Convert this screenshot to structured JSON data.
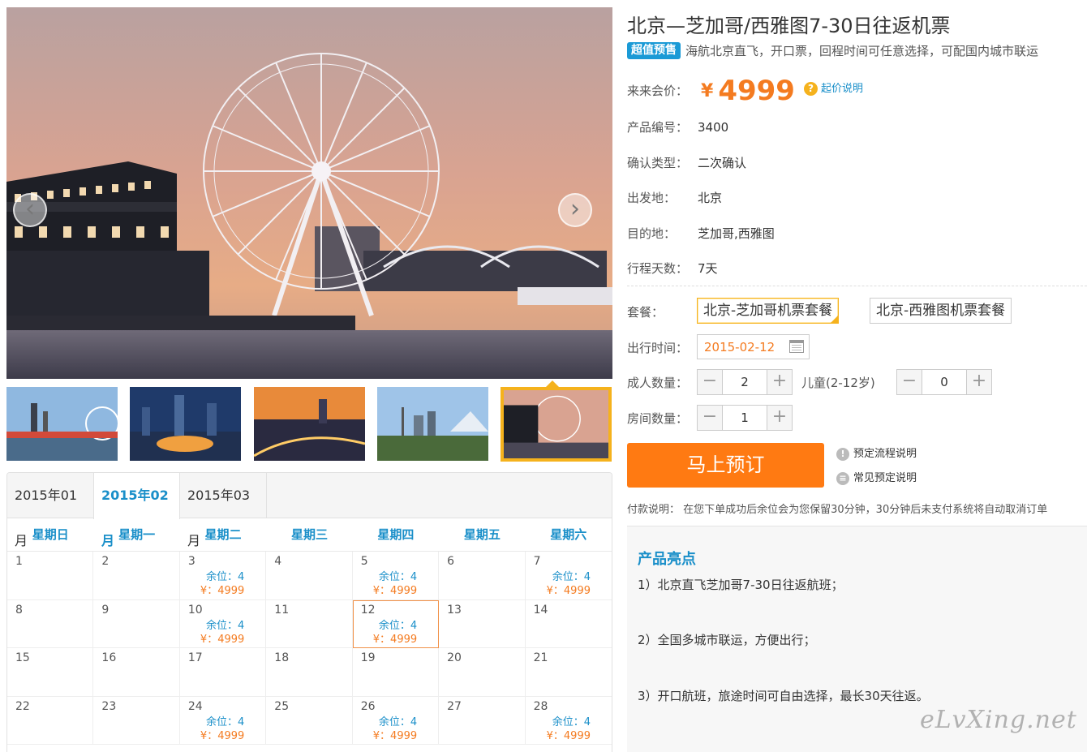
{
  "product": {
    "title": "北京—芝加哥/西雅图7-30日往返机票",
    "badge": "超值预售",
    "subtitle": "海航北京直飞，开口票，回程时间可任意选择，可配国内城市联运",
    "price_label": "来来会价：",
    "currency": "¥",
    "price": "4999",
    "price_note": "起价说明",
    "price_note_icon": "?",
    "fields": [
      {
        "label": "产品编号：",
        "value": "3400"
      },
      {
        "label": "确认类型：",
        "value": "二次确认"
      },
      {
        "label": "出发地：",
        "value": "北京"
      },
      {
        "label": "目的地：",
        "value": "芝加哥,西雅图"
      },
      {
        "label": "行程天数：",
        "value": "7天"
      }
    ]
  },
  "booking": {
    "package_label": "套餐：",
    "packages": [
      "北京-芝加哥机票套餐",
      "北京-西雅图机票套餐"
    ],
    "selected_package": 0,
    "date_label": "出行时间：",
    "date_value": "2015-02-12",
    "adult_label": "成人数量：",
    "adults": "2",
    "child_label": "儿童(2-12岁)",
    "children": "0",
    "room_label": "房间数量：",
    "rooms": "1",
    "minus": "−",
    "plus": "+",
    "book_button": "马上预订",
    "help_links": [
      "预定流程说明",
      "常见预定说明"
    ],
    "help_icons": [
      "!",
      "≡"
    ],
    "pay_note": "付款说明：  在您下单成功后余位会为您保留30分钟，30分钟后未支付系统将自动取消订单"
  },
  "highlights": {
    "title": "产品亮点",
    "items": [
      "1）北京直飞芝加哥7-30日往返航班；",
      "2）全国多城市联运，方便出行；",
      "3）开口航班，旅途时间可自由选择，最长30天往返。"
    ]
  },
  "gallery": {
    "prev_icon": "‹",
    "next_icon": "›",
    "active_thumb": 4
  },
  "calendar": {
    "tabs": [
      "2015年01月",
      "2015年02月",
      "2015年03月"
    ],
    "active_tab": 1,
    "weekdays": [
      "星期日",
      "星期一",
      "星期二",
      "星期三",
      "星期四",
      "星期五",
      "星期六"
    ],
    "selected_day": "12",
    "days": [
      {
        "d": "1"
      },
      {
        "d": "2"
      },
      {
        "d": "3",
        "seat": "余位：4",
        "price": "¥：4999"
      },
      {
        "d": "4"
      },
      {
        "d": "5",
        "seat": "余位：4",
        "price": "¥：4999"
      },
      {
        "d": "6"
      },
      {
        "d": "7",
        "seat": "余位：4",
        "price": "¥：4999"
      },
      {
        "d": "8"
      },
      {
        "d": "9"
      },
      {
        "d": "10",
        "seat": "余位：4",
        "price": "¥：4999"
      },
      {
        "d": "11"
      },
      {
        "d": "12",
        "seat": "余位：4",
        "price": "¥：4999"
      },
      {
        "d": "13"
      },
      {
        "d": "14"
      },
      {
        "d": "15"
      },
      {
        "d": "16"
      },
      {
        "d": "17"
      },
      {
        "d": "18"
      },
      {
        "d": "19"
      },
      {
        "d": "20"
      },
      {
        "d": "21"
      },
      {
        "d": "22"
      },
      {
        "d": "23"
      },
      {
        "d": "24",
        "seat": "余位：4",
        "price": "¥：4999"
      },
      {
        "d": "25"
      },
      {
        "d": "26",
        "seat": "余位：4",
        "price": "¥：4999"
      },
      {
        "d": "27"
      },
      {
        "d": "28",
        "seat": "余位：4",
        "price": "¥：4999"
      }
    ]
  },
  "watermark": "eLvXing.net",
  "colors": {
    "accent_blue": "#1a8fc9",
    "accent_orange": "#f47b20",
    "book_button": "#ff7a12",
    "thumb_highlight": "#f5b21d"
  }
}
